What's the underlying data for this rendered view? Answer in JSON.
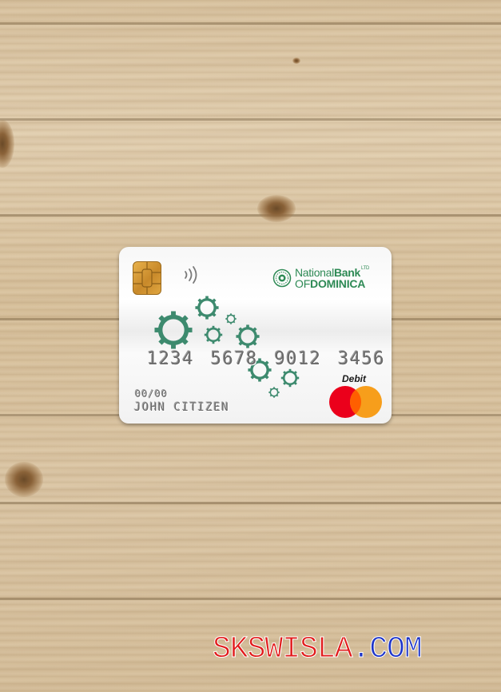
{
  "card": {
    "bank_name_line1_regular": "National",
    "bank_name_line1_bold": "Bank",
    "bank_suffix": "LTD",
    "bank_name_line2_regular": "OF",
    "bank_name_line2_bold": "DOMINICA",
    "number": "1234 5678 9012 3456",
    "expiry": "00/00",
    "holder": "JOHN CITIZEN",
    "type_label": "Debit",
    "network_icon": "mastercard-logo-icon",
    "colors": {
      "brand_green": "#2e8a55",
      "gear_green": "#3d8a6e",
      "mastercard_red": "#eb001b",
      "mastercard_yellow": "#f79e1b"
    }
  },
  "watermark": {
    "part1": "SKSWISLA",
    "dot": ".",
    "part2": "COM",
    "colors": {
      "part1": "#e11b1b",
      "part2": "#1d34c9"
    }
  }
}
